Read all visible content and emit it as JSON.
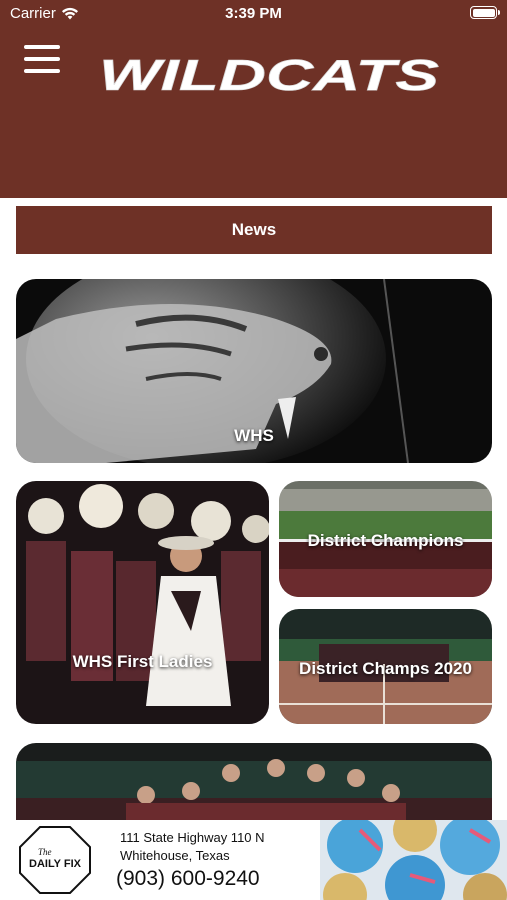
{
  "status_bar": {
    "carrier": "Carrier",
    "time": "3:39 PM",
    "wifi_icon": "wifi-icon",
    "battery_icon": "battery-icon"
  },
  "header": {
    "menu_icon": "hamburger-menu-icon",
    "logo_text": "WILDCATS",
    "background_color": "#6e3126"
  },
  "news_bar": {
    "label": "News"
  },
  "tiles": [
    {
      "label": "WHS"
    },
    {
      "label": "WHS First Ladies"
    },
    {
      "label": "District Champions"
    },
    {
      "label": "District Champs 2020"
    },
    {
      "label": ""
    }
  ],
  "ad": {
    "logo_text": "DAILY FIX",
    "logo_small": "The",
    "address_line1": "111 State Highway 110 N",
    "address_line2": "Whitehouse, Texas",
    "phone": "(903) 600-9240"
  },
  "colors": {
    "brand": "#6e3126",
    "text_on_brand": "#ffffff"
  }
}
